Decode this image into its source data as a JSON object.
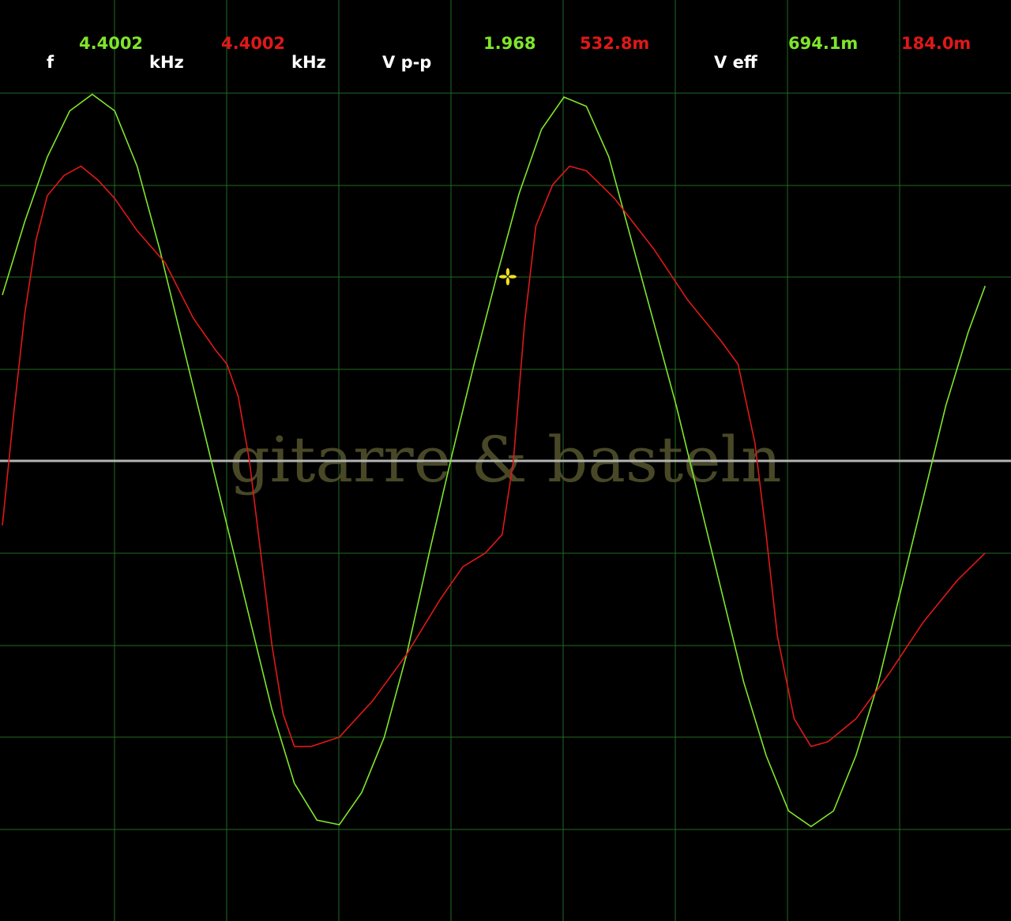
{
  "readout": {
    "f_label": "f",
    "f_ch1": "4.4002",
    "f_unit_ch1": "kHz",
    "f_ch2": "4.4002",
    "f_unit_ch2": "kHz",
    "vpp_label": "V p-p",
    "vpp_ch1": "1.968",
    "vpp_ch2": "532.8m",
    "veff_label": "V eff",
    "veff_ch1": "694.1m",
    "veff_ch2": "184.0m"
  },
  "watermark": "gitarre & basteln",
  "colors": {
    "background": "#000000",
    "grid": "#1f6b1f",
    "ch1": "#7fe62a",
    "ch2": "#e01818",
    "label": "#ffffff",
    "baseline": "#b4b4b4",
    "cursor": "#f0e020"
  },
  "chart_data": {
    "type": "line",
    "grid": true,
    "grid_divisions": {
      "x": 9,
      "y": 8
    },
    "x_range_div": [
      0,
      9
    ],
    "y_range_div": [
      -4,
      4
    ],
    "series": [
      {
        "points": [
          [
            0.0,
            1.8
          ],
          [
            0.2,
            2.6
          ],
          [
            0.4,
            3.3
          ],
          [
            0.6,
            3.8
          ],
          [
            0.8,
            3.98
          ],
          [
            1.0,
            3.8
          ],
          [
            1.2,
            3.2
          ],
          [
            1.4,
            2.3
          ],
          [
            1.6,
            1.3
          ],
          [
            1.8,
            0.3
          ],
          [
            2.0,
            -0.7
          ],
          [
            2.2,
            -1.7
          ],
          [
            2.4,
            -2.7
          ],
          [
            2.6,
            -3.5
          ],
          [
            2.8,
            -3.9
          ],
          [
            3.0,
            -3.95
          ],
          [
            3.2,
            -3.6
          ],
          [
            3.4,
            -3.0
          ],
          [
            3.6,
            -2.1
          ],
          [
            3.8,
            -1.0
          ],
          [
            4.0,
            0.05
          ],
          [
            4.2,
            1.05
          ],
          [
            4.4,
            2.0
          ],
          [
            4.6,
            2.9
          ],
          [
            4.8,
            3.6
          ],
          [
            5.0,
            3.95
          ],
          [
            5.2,
            3.85
          ],
          [
            5.4,
            3.3
          ],
          [
            5.6,
            2.4
          ],
          [
            5.8,
            1.5
          ],
          [
            6.0,
            0.6
          ],
          [
            6.2,
            -0.4
          ],
          [
            6.4,
            -1.4
          ],
          [
            6.6,
            -2.4
          ],
          [
            6.8,
            -3.2
          ],
          [
            7.0,
            -3.8
          ],
          [
            7.2,
            -3.97
          ],
          [
            7.4,
            -3.8
          ],
          [
            7.6,
            -3.2
          ],
          [
            7.8,
            -2.4
          ],
          [
            8.0,
            -1.4
          ],
          [
            8.2,
            -0.4
          ],
          [
            8.4,
            0.6
          ],
          [
            8.6,
            1.4
          ],
          [
            8.75,
            1.9
          ]
        ]
      },
      {
        "points": [
          [
            0.0,
            -0.7
          ],
          [
            0.1,
            0.5
          ],
          [
            0.2,
            1.6
          ],
          [
            0.3,
            2.4
          ],
          [
            0.4,
            2.88
          ],
          [
            0.55,
            3.1
          ],
          [
            0.7,
            3.2
          ],
          [
            0.85,
            3.05
          ],
          [
            1.0,
            2.85
          ],
          [
            1.2,
            2.5
          ],
          [
            1.45,
            2.15
          ],
          [
            1.7,
            1.55
          ],
          [
            1.9,
            1.2
          ],
          [
            2.0,
            1.05
          ],
          [
            2.1,
            0.7
          ],
          [
            2.2,
            0.0
          ],
          [
            2.3,
            -1.0
          ],
          [
            2.4,
            -2.0
          ],
          [
            2.5,
            -2.75
          ],
          [
            2.6,
            -3.1
          ],
          [
            2.75,
            -3.1
          ],
          [
            3.0,
            -3.0
          ],
          [
            3.3,
            -2.6
          ],
          [
            3.6,
            -2.1
          ],
          [
            3.9,
            -1.5
          ],
          [
            4.1,
            -1.15
          ],
          [
            4.3,
            -1.0
          ],
          [
            4.45,
            -0.8
          ],
          [
            4.55,
            0.0
          ],
          [
            4.65,
            1.5
          ],
          [
            4.75,
            2.55
          ],
          [
            4.9,
            3.0
          ],
          [
            5.05,
            3.2
          ],
          [
            5.2,
            3.15
          ],
          [
            5.45,
            2.85
          ],
          [
            5.8,
            2.3
          ],
          [
            6.1,
            1.75
          ],
          [
            6.4,
            1.3
          ],
          [
            6.55,
            1.05
          ],
          [
            6.7,
            0.2
          ],
          [
            6.8,
            -0.8
          ],
          [
            6.9,
            -1.9
          ],
          [
            7.05,
            -2.8
          ],
          [
            7.2,
            -3.1
          ],
          [
            7.35,
            -3.05
          ],
          [
            7.6,
            -2.8
          ],
          [
            7.9,
            -2.3
          ],
          [
            8.2,
            -1.75
          ],
          [
            8.5,
            -1.3
          ],
          [
            8.75,
            -1.0
          ]
        ]
      }
    ],
    "baseline_div": 0,
    "cursor_point_div": [
      4.5,
      2.0
    ]
  }
}
